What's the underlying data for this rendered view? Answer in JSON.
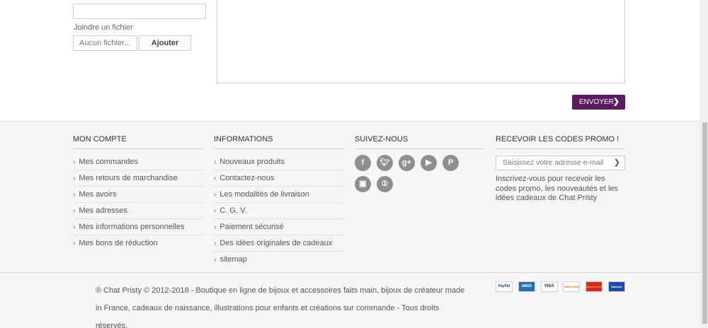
{
  "form": {
    "attach_label": "Joindre un fichier",
    "file_name": "Aucun fichier...",
    "file_button": "Ajouter",
    "send_button": "ENVOYER"
  },
  "footer": {
    "account": {
      "title": "MON COMPTE",
      "items": [
        "Mes commandes",
        "Mes retours de marchandise",
        "Mes avoirs",
        "Mes adresses",
        "Mes informations personnelles",
        "Mes bons de réduction"
      ]
    },
    "info": {
      "title": "INFORMATIONS",
      "items": [
        "Nouveaux produits",
        "Contactez-nous",
        "Les modalités de livraison",
        "C. G. V.",
        "Paiement sécurisé",
        "Des idées originales de cadeaux",
        "sitemap"
      ]
    },
    "social": {
      "title": "SUIVEZ-NOUS",
      "icons": [
        "facebook-icon",
        "twitter-icon",
        "google-plus-icon",
        "youtube-icon",
        "pinterest-icon",
        "instagram-icon",
        "rss-icon"
      ]
    },
    "newsletter": {
      "title": "RECEVOIR LES CODES PROMO !",
      "placeholder": "Saisissez votre adresse e-mail",
      "text": "Inscrivez-vous pour recevoir les codes promo, les nouveautés et les idées cadeaux de Chat Pristy"
    },
    "copyright": "® Chat Pristy © 2012-2018 - Boutique en ligne de bijoux et accessoires faits main, bijoux de créateur made in France, cadeaux de naissance, illustrations pour enfants et créations sur commande - Tous droits réservés.",
    "payments": [
      "PayPal",
      "AMEX",
      "VISA",
      "DISCOVER",
      "MasterCard",
      "Maestro"
    ]
  }
}
